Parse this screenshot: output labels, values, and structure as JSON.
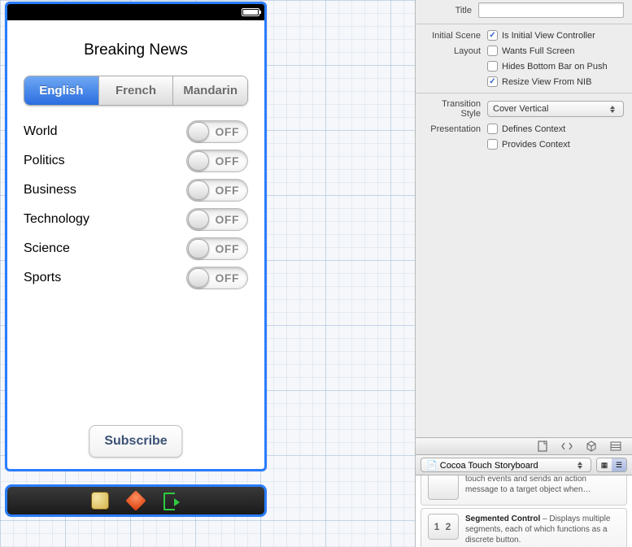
{
  "phone": {
    "title": "Breaking News",
    "segments": [
      "English",
      "French",
      "Mandarin"
    ],
    "active_segment": 0,
    "toggles": [
      {
        "label": "World",
        "state": "OFF"
      },
      {
        "label": "Politics",
        "state": "OFF"
      },
      {
        "label": "Business",
        "state": "OFF"
      },
      {
        "label": "Technology",
        "state": "OFF"
      },
      {
        "label": "Science",
        "state": "OFF"
      },
      {
        "label": "Sports",
        "state": "OFF"
      }
    ],
    "subscribe_label": "Subscribe"
  },
  "inspector": {
    "title_label": "Title",
    "title_value": "",
    "initial_scene_label": "Initial Scene",
    "is_initial_vc": {
      "label": "Is Initial View Controller",
      "checked": true
    },
    "layout_label": "Layout",
    "wants_full_screen": {
      "label": "Wants Full Screen",
      "checked": false
    },
    "hides_bottom_bar": {
      "label": "Hides Bottom Bar on Push",
      "checked": false
    },
    "resize_from_nib": {
      "label": "Resize View From NIB",
      "checked": true
    },
    "transition_label": "Transition Style",
    "transition_value": "Cover Vertical",
    "presentation_label": "Presentation",
    "defines_context": {
      "label": "Defines Context",
      "checked": false
    },
    "provides_context": {
      "label": "Provides Context",
      "checked": false
    }
  },
  "library": {
    "filter_value": "Cocoa Touch Storyboard",
    "partial_item_text": "touch events and sends an action message to a target object when…",
    "seg_item_title": "Segmented Control",
    "seg_item_desc": " – Displays multiple segments, each of which functions as a discrete button.",
    "seg_thumb": "1  2"
  }
}
